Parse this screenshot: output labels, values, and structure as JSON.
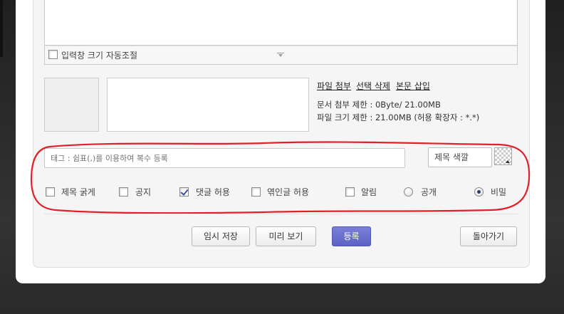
{
  "editor": {
    "auto_resize_label": "입력창 크기 자동조절"
  },
  "attachments": {
    "links": [
      "파일 첨부",
      "선택 삭제",
      "본문 삽입"
    ],
    "limit_line": "문서 첨부 제한 : 0Byte/ 21.00MB",
    "size_line": "파일 크기 제한 : 21.00MB (허용 확장자 : *.*)"
  },
  "tags": {
    "placeholder": "태그 : 쉼표(,)를 이용하여 복수 등록"
  },
  "title_color": {
    "label": "제목 색깔",
    "icon": "transparent-swatch-icon"
  },
  "options": {
    "bold_title": "제목 굵게",
    "notice": "공지",
    "allow_comments": "댓글 허용",
    "allow_trackback": "엮인글 허용",
    "notify": "알림",
    "public": "공개",
    "private": "비밀"
  },
  "option_state": {
    "bold_title": false,
    "notice": false,
    "allow_comments": true,
    "allow_trackback": false,
    "notify": false,
    "visibility": "private"
  },
  "buttons": {
    "temp_save": "임시 저장",
    "preview": "미리 보기",
    "submit": "등록",
    "back": "돌아가기"
  },
  "colors": {
    "annotation_red": "#e0202a",
    "submit_button": "#6066c8",
    "background": "#2a2a2a"
  }
}
